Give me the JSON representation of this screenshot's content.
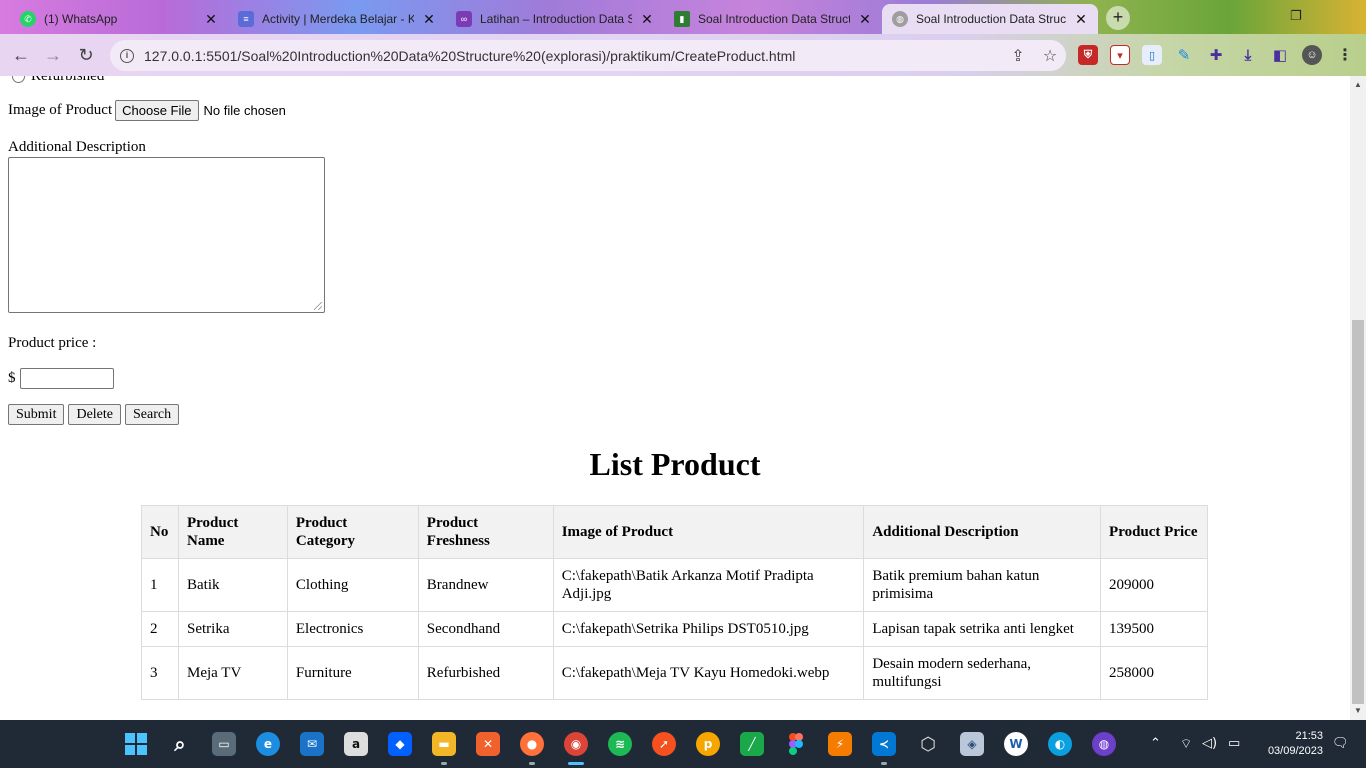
{
  "browser": {
    "tabs": [
      {
        "label": "(1) WhatsApp",
        "icon": "whatsapp-icon",
        "color": "#25d366"
      },
      {
        "label": "Activity | Merdeka Belajar - K",
        "icon": "merdeka-icon",
        "color": "#5b6bd8"
      },
      {
        "label": "Latihan – Introduction Data S",
        "icon": "onenote-icon",
        "color": "#7a3bb5"
      },
      {
        "label": "Soal Introduction Data Struct",
        "icon": "book-icon",
        "color": "#2e7d32"
      },
      {
        "label": "Soal Introduction Data Struct",
        "icon": "globe-icon",
        "color": "#9e9e9e"
      }
    ],
    "url": "127.0.0.1:5501/Soal%20Introduction%20Data%20Structure%20(explorasi)/praktikum/CreateProduct.html"
  },
  "form": {
    "radio_label": "Refurbished",
    "image_label": "Image of Product",
    "choose_file": "Choose File",
    "file_status": "No file chosen",
    "description_label": "Additional Description",
    "price_label": "Product price :",
    "currency": "$",
    "submit": "Submit",
    "delete": "Delete",
    "search": "Search"
  },
  "list": {
    "title": "List Product",
    "headers": [
      "No",
      "Product Name",
      "Product Category",
      "Product Freshness",
      "Image of Product",
      "Additional Description",
      "Product Price"
    ],
    "rows": [
      [
        "1",
        "Batik",
        "Clothing",
        "Brandnew",
        "C:\\fakepath\\Batik Arkanza Motif Pradipta Adji.jpg",
        "Batik premium bahan katun primisima",
        "209000"
      ],
      [
        "2",
        "Setrika",
        "Electronics",
        "Secondhand",
        "C:\\fakepath\\Setrika Philips DST0510.jpg",
        "Lapisan tapak setrika anti lengket",
        "139500"
      ],
      [
        "3",
        "Meja TV",
        "Furniture",
        "Refurbished",
        "C:\\fakepath\\Meja TV Kayu Homedoki.webp",
        "Desain modern sederhana, multifungsi",
        "258000"
      ]
    ]
  },
  "taskbar": {
    "time": "21:53",
    "date": "03/09/2023"
  }
}
